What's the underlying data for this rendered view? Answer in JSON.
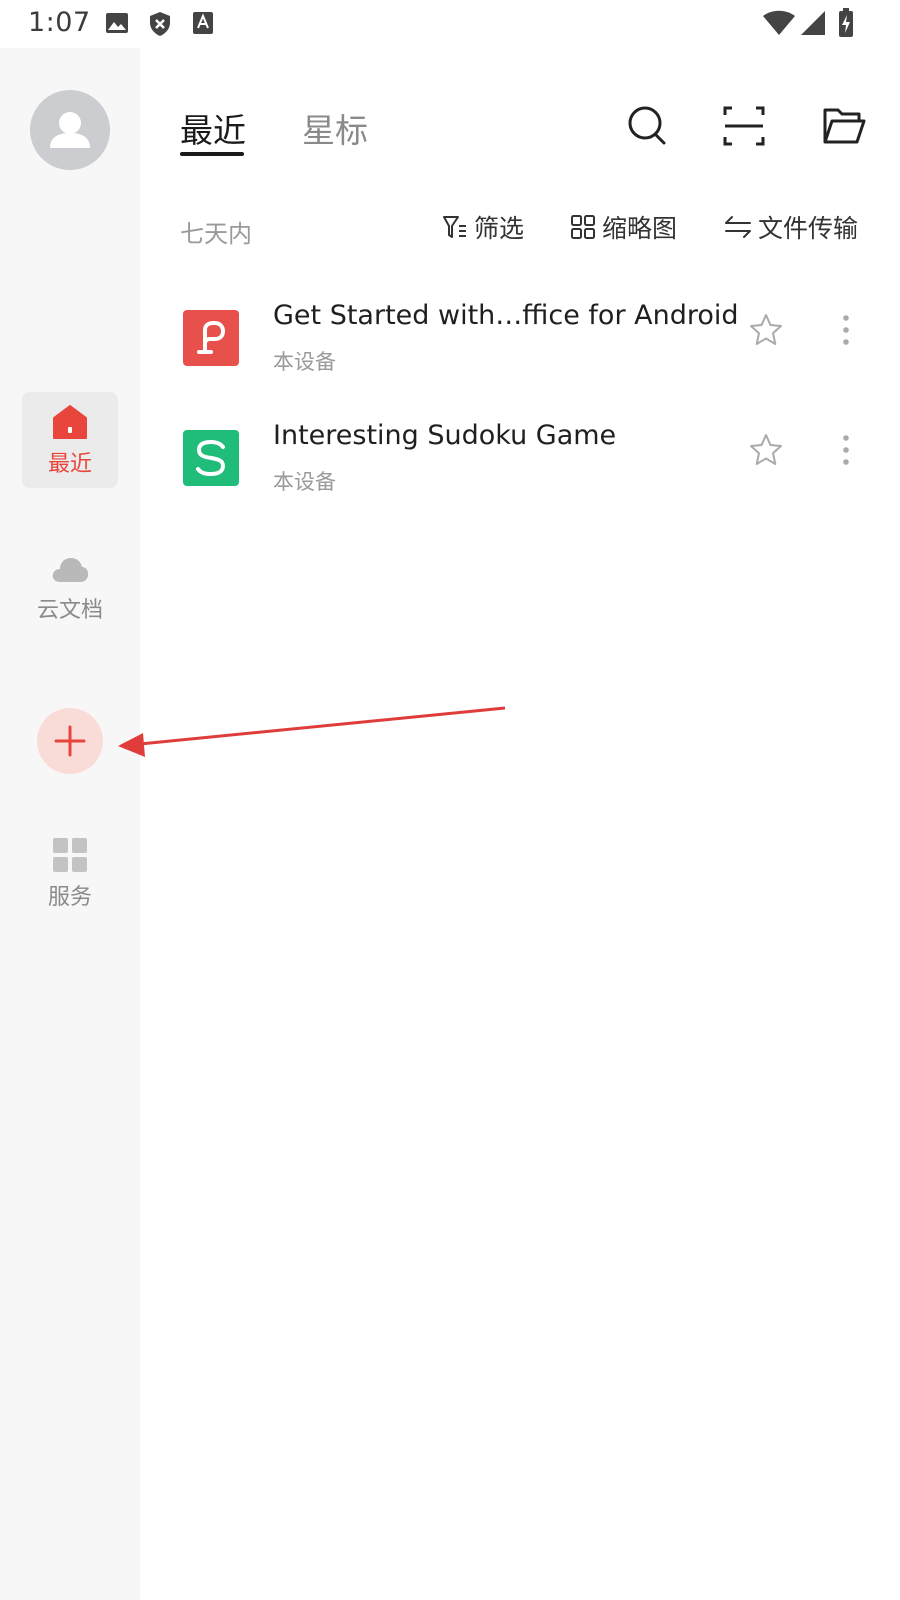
{
  "status_bar": {
    "time": "1:07",
    "icons": [
      "image-icon",
      "shield-x-icon",
      "text-a-icon",
      "wifi-icon",
      "signal-icon",
      "battery-charging-icon"
    ]
  },
  "sidebar": {
    "avatar_icon": "person-icon",
    "items": [
      {
        "label": "最近",
        "icon": "home-icon",
        "active": true
      },
      {
        "label": "云文档",
        "icon": "cloud-icon",
        "active": false
      },
      {
        "label": "服务",
        "icon": "grid-icon",
        "active": false
      }
    ],
    "add_icon": "plus-icon"
  },
  "header": {
    "tabs": [
      {
        "label": "最近",
        "active": true
      },
      {
        "label": "星标",
        "active": false
      }
    ],
    "actions": [
      "search-icon",
      "scan-icon",
      "folder-open-icon"
    ]
  },
  "filter_bar": {
    "range_label": "七天内",
    "filter_label": "筛选",
    "thumbnail_label": "缩略图",
    "transfer_label": "文件传输"
  },
  "files": [
    {
      "name": "Get Started with…ffice for Android",
      "location": "本设备",
      "type": "presentation",
      "color": "#e8504c"
    },
    {
      "name": "Interesting Sudoku Game",
      "location": "本设备",
      "type": "spreadsheet",
      "color": "#1fbd79"
    }
  ],
  "colors": {
    "accent": "#e8453c",
    "sidebar_bg": "#f7f7f7",
    "annotation_arrow": "#e03c3c"
  }
}
